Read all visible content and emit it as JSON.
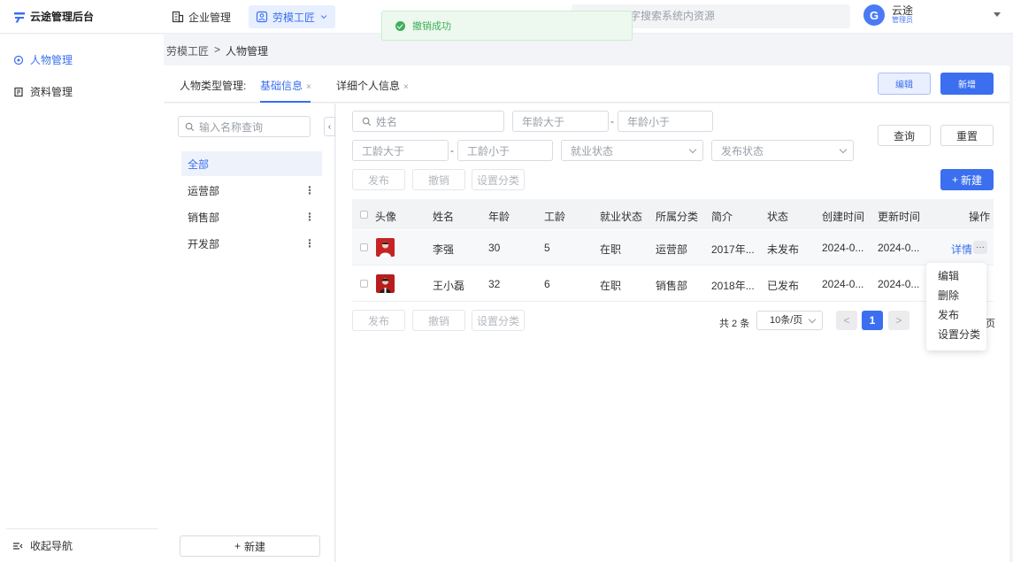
{
  "app": {
    "logo_text": "云途管理后台"
  },
  "topnav": {
    "enterprise": "企业管理",
    "labor": "劳模工匠"
  },
  "global_search": {
    "placeholder": "字搜索系统内资源"
  },
  "toast": {
    "message": "撤销成功"
  },
  "user": {
    "initial": "G",
    "name": "云途",
    "role": "管理员"
  },
  "sidebar": {
    "items": [
      {
        "label": "人物管理"
      },
      {
        "label": "资料管理"
      }
    ],
    "collapse_label": "收起导航"
  },
  "breadcrumb": {
    "root": "劳模工匠",
    "sep": ">",
    "current": "人物管理"
  },
  "tabs": {
    "prefix": "人物类型管理:",
    "items": [
      {
        "label": "基础信息"
      },
      {
        "label": "详细个人信息"
      }
    ],
    "close": "×",
    "edit_label": "编辑",
    "add_label": "新增"
  },
  "category_panel": {
    "search_placeholder": "输入名称查询",
    "collapse_glyph": "‹",
    "items": [
      {
        "label": "全部"
      },
      {
        "label": "运营部"
      },
      {
        "label": "销售部"
      },
      {
        "label": "开发部"
      }
    ],
    "more_glyph": "⋮",
    "new_label": "新建",
    "plus": "+"
  },
  "filters": {
    "name_placeholder": "姓名",
    "age_min_placeholder": "年龄大于",
    "age_max_placeholder": "年龄小于",
    "seniority_min_placeholder": "工龄大于",
    "seniority_max_placeholder": "工龄小于",
    "employment_placeholder": "就业状态",
    "publish_placeholder": "发布状态",
    "dash": "-",
    "query_label": "查询",
    "reset_label": "重置"
  },
  "bulk_actions": {
    "publish": "发布",
    "revoke": "撤销",
    "set_category": "设置分类",
    "new_label": "新建",
    "plus": "+"
  },
  "table": {
    "columns": [
      "头像",
      "姓名",
      "年龄",
      "工龄",
      "就业状态",
      "所属分类",
      "简介",
      "状态",
      "创建时间",
      "更新时间",
      "操作"
    ],
    "rows": [
      {
        "name": "李强",
        "age": "30",
        "seniority": "5",
        "employment": "在职",
        "category": "运营部",
        "intro": "2017年...",
        "status": "未发布",
        "created": "2024-0...",
        "updated": "2024-0...",
        "action": "详情",
        "more": "···"
      },
      {
        "name": "王小磊",
        "age": "32",
        "seniority": "6",
        "employment": "在职",
        "category": "销售部",
        "intro": "2018年...",
        "status": "已发布",
        "created": "2024-0...",
        "updated": "2024-0..."
      }
    ]
  },
  "pagination": {
    "total_text": "共 2 条",
    "page_size": "10条/页",
    "prev": "<",
    "current_page": "1",
    "next": ">",
    "tail": "页"
  },
  "row_menu": {
    "items": [
      "编辑",
      "删除",
      "发布",
      "设置分类"
    ]
  },
  "colors": {
    "primary": "#3b6ff0",
    "success": "#3fae5b",
    "background": "#f3f4f7"
  }
}
